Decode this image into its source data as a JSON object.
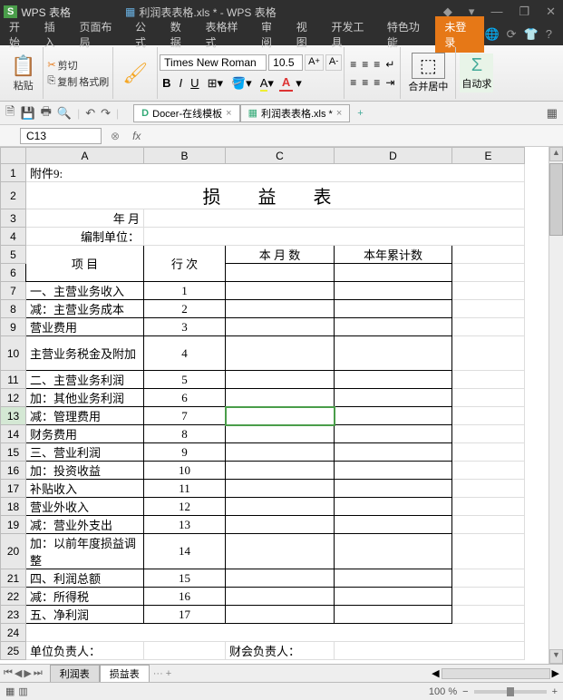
{
  "app": {
    "logo": "S",
    "name": "WPS 表格",
    "filename": "利润表表格.xls * - WPS 表格"
  },
  "window_controls": {
    "min": "—",
    "restore": "❐",
    "close": "✕",
    "menu": "▾",
    "help": "?"
  },
  "menu": {
    "items": [
      "开始",
      "插入",
      "页面布局",
      "公式",
      "数据",
      "表格样式",
      "审阅",
      "视图",
      "开发工具",
      "特色功能"
    ],
    "login": "未登录"
  },
  "ribbon": {
    "paste": "粘贴",
    "cut": "剪切",
    "copy": "复制",
    "format_painter": "格式刷",
    "font_name": "Times New Roman",
    "font_size": "10.5",
    "merge": "合并居中",
    "autosum": "自动求"
  },
  "tabs": {
    "docer": "Docer-在线模板",
    "file": "利润表表格.xls *"
  },
  "namebox": "C13",
  "fx": "fx",
  "sheet": {
    "attach": "附件9:",
    "title": "损  益  表",
    "yearmonth": "年      月",
    "compiler": "编制单位：",
    "h_item": "项        目",
    "h_line": "行 次",
    "h_month": "本 月 数",
    "h_year": "本年累计数",
    "rows": [
      {
        "n": "7",
        "item": "一、主营业务收入",
        "line": "1"
      },
      {
        "n": "8",
        "item": "减：主营业务成本",
        "line": "2"
      },
      {
        "n": "9",
        "item": "营业费用",
        "line": "3"
      },
      {
        "n": "10",
        "item": "主营业务税金及附加",
        "line": "4"
      },
      {
        "n": "11",
        "item": "二、主营业务利润",
        "line": "5"
      },
      {
        "n": "12",
        "item": "加：其他业务利润",
        "line": "6"
      },
      {
        "n": "13",
        "item": "减：管理费用",
        "line": "7"
      },
      {
        "n": "14",
        "item": "财务费用",
        "line": "8"
      },
      {
        "n": "15",
        "item": "三、营业利润",
        "line": "9"
      },
      {
        "n": "16",
        "item": "加：投资收益",
        "line": "10"
      },
      {
        "n": "17",
        "item": "补贴收入",
        "line": "11"
      },
      {
        "n": "18",
        "item": "营业外收入",
        "line": "12"
      },
      {
        "n": "19",
        "item": "减：营业外支出",
        "line": "13"
      },
      {
        "n": "20",
        "item": "加：以前年度损益调整",
        "line": "14"
      },
      {
        "n": "21",
        "item": "四、利润总额",
        "line": "15"
      },
      {
        "n": "22",
        "item": "减：所得税",
        "line": "16"
      },
      {
        "n": "23",
        "item": "五、净利润",
        "line": "17"
      }
    ],
    "unit_leader": "单位负责人：",
    "fin_leader": "财会负责人："
  },
  "sheets": {
    "tab1": "利润表",
    "tab2": "损益表"
  },
  "status": {
    "zoom": "100 %"
  },
  "cols": [
    "A",
    "B",
    "C",
    "D",
    "E"
  ]
}
